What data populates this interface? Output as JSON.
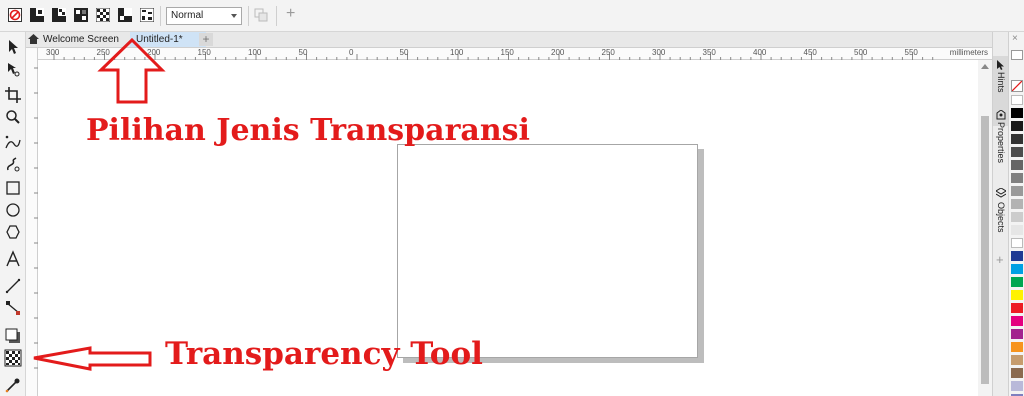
{
  "property_bar": {
    "transparency_mode": "Normal",
    "transparency_type_icons": [
      "no-transparency-icon",
      "uniform-transparency-icon",
      "fountain-transparency-icon",
      "vector-pattern-transparency-icon",
      "bitmap-pattern-transparency-icon",
      "two-color-pattern-transparency-icon",
      "texture-transparency-icon"
    ],
    "add_symbol": "+"
  },
  "tabs": {
    "welcome": "Welcome Screen",
    "document": "Untitled-1*",
    "new_tab": "+"
  },
  "ruler": {
    "units": "millimeters",
    "labels": [
      "300",
      "250",
      "200",
      "150",
      "100",
      "50",
      "0",
      "50",
      "100",
      "150",
      "200",
      "250",
      "300",
      "350",
      "400",
      "450",
      "500",
      "550"
    ]
  },
  "docker": {
    "hints": "Hints",
    "properties": "Properties",
    "objects": "Objects",
    "close": "×",
    "add": "+"
  },
  "palette": {
    "colors": [
      "#ffffff",
      "#000000",
      "#1a1a1a",
      "#333333",
      "#4d4d4d",
      "#666666",
      "#808080",
      "#999999",
      "#b3b3b3",
      "#cccccc",
      "#e6e6e6",
      "#ffffff",
      "#1f3a93",
      "#00a0e3",
      "#00a651",
      "#fff200",
      "#ed1c24",
      "#e4007f",
      "#a3238e",
      "#f7941d",
      "#c69c6d",
      "#8b6a4f",
      "#b9b9d9",
      "#7f7fbf"
    ]
  },
  "annotations": {
    "top_label": "Pilihan Jenis Transparansi",
    "bottom_label": "Transparency Tool"
  },
  "colors": {
    "annotation": "#e31b1b",
    "active_tab": "#cfe3f6"
  }
}
